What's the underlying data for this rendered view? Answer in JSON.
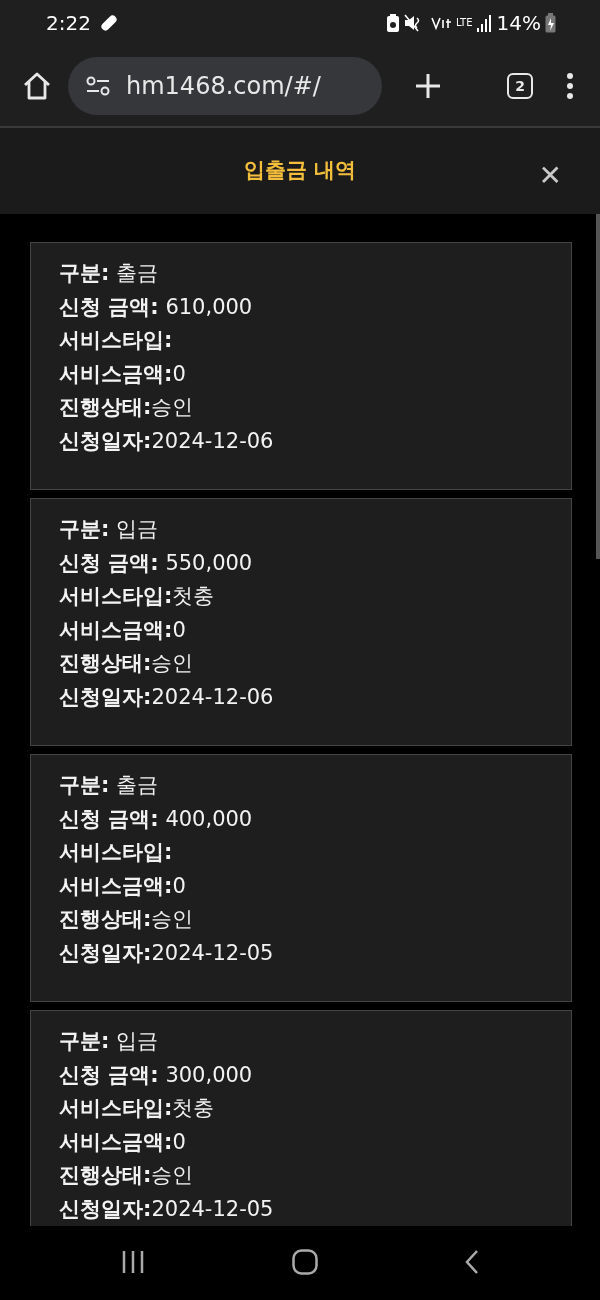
{
  "status_bar": {
    "time": "2:22",
    "network": "LTE",
    "battery": "14%"
  },
  "browser": {
    "url": "hm1468.com/#/",
    "tab_count": "2"
  },
  "dialog": {
    "title": "입출금 내역",
    "close": "✕"
  },
  "records": [
    {
      "lines": [
        "**구분:** 출금",
        "**신청 금액:** 610,000",
        "**서비스타입:**",
        "**서비스금액:**0",
        "**진행상태:**승인",
        "**신청일자:**2024-12-06"
      ]
    },
    {
      "lines": [
        "**구분:** 입금",
        "**신청 금액:** 550,000",
        "**서비스타입:**첫충",
        "**서비스금액:**0",
        "**진행상태:**승인",
        "**신청일자:**2024-12-06"
      ]
    },
    {
      "lines": [
        "**구분:** 출금",
        "**신청 금액:** 400,000",
        "**서비스타입:**",
        "**서비스금액:**0",
        "**진행상태:**승인",
        "**신청일자:**2024-12-05"
      ]
    },
    {
      "lines": [
        "**구분:** 입금",
        "**신청 금액:** 300,000",
        "**서비스타입:**첫충",
        "**서비스금액:**0",
        "**진행상태:**승인",
        "**신청일자:**2024-12-05"
      ]
    }
  ]
}
